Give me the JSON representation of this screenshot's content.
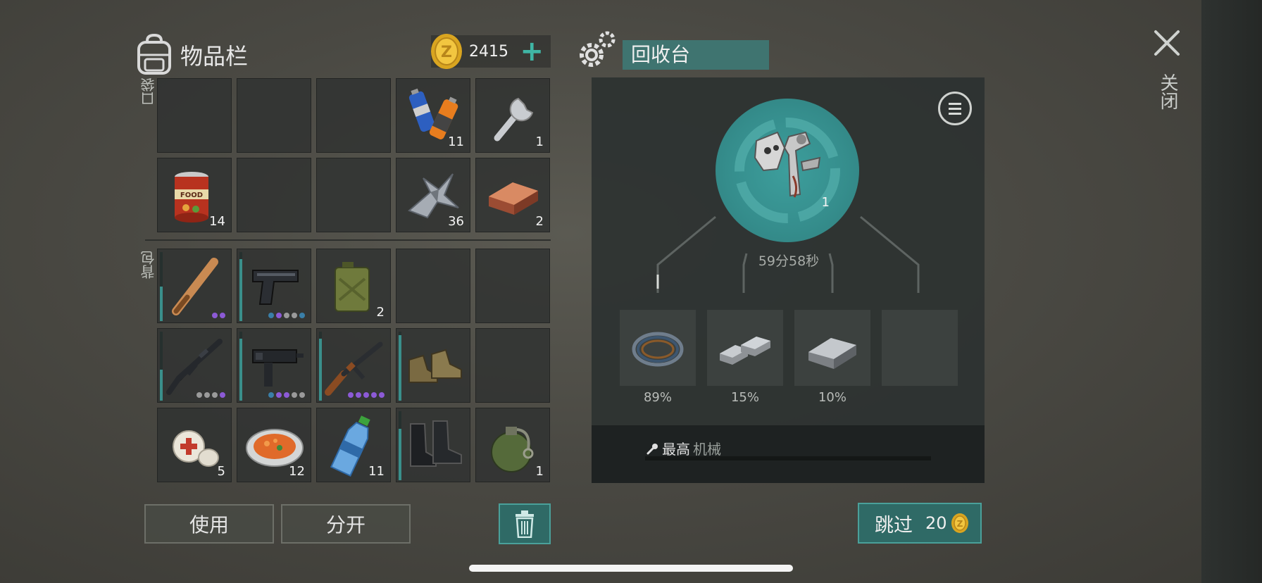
{
  "inventory": {
    "title": "物品栏",
    "coins": "2415",
    "plus": "+",
    "pocket_label": "口袋",
    "backpack_label": "背包",
    "pocket_slots": [
      {
        "icon": "",
        "qty": ""
      },
      {
        "icon": "",
        "qty": ""
      },
      {
        "icon": "",
        "qty": ""
      },
      {
        "icon": "batteries-icon",
        "qty": "11"
      },
      {
        "icon": "wrench-icon",
        "qty": "1"
      },
      {
        "icon": "canned-food-icon",
        "qty": "14"
      },
      {
        "icon": "",
        "qty": ""
      },
      {
        "icon": "",
        "qty": ""
      },
      {
        "icon": "scrap-metal-icon",
        "qty": "36"
      },
      {
        "icon": "copper-ingot-icon",
        "qty": "2"
      }
    ],
    "backpack_slots": [
      {
        "icon": "baseball-bat-icon",
        "qty": "",
        "durability": 0.5,
        "upgrade_dots": [
          "#8c5ad6",
          "#8c5ad6"
        ]
      },
      {
        "icon": "pistol-icon",
        "qty": "",
        "durability": 0.9,
        "upgrade_dots": [
          "#3a7fa8",
          "#8c5ad6",
          "#9a9a9a",
          "#9a9a9a",
          "#3a7fa8"
        ]
      },
      {
        "icon": "jerrycan-icon",
        "qty": "2",
        "durability": null,
        "upgrade_dots": []
      },
      {
        "icon": "",
        "qty": "",
        "durability": null,
        "upgrade_dots": []
      },
      {
        "icon": "",
        "qty": "",
        "durability": null,
        "upgrade_dots": []
      },
      {
        "icon": "assault-rifle-icon",
        "qty": "",
        "durability": 0.45,
        "upgrade_dots": [
          "#9a9a9a",
          "#9a9a9a",
          "#9a9a9a",
          "#8c5ad6"
        ]
      },
      {
        "icon": "uzi-icon",
        "qty": "",
        "durability": 0.9,
        "upgrade_dots": [
          "#3a7fa8",
          "#8c5ad6",
          "#8c5ad6",
          "#9a9a9a",
          "#9a9a9a"
        ]
      },
      {
        "icon": "ak-rifle-icon",
        "qty": "",
        "durability": 0.9,
        "upgrade_dots": [
          "#8c5ad6",
          "#8c5ad6",
          "#8c5ad6",
          "#8c5ad6",
          "#8c5ad6"
        ]
      },
      {
        "icon": "boots-icon",
        "qty": "",
        "durability": 0.95,
        "upgrade_dots": []
      },
      {
        "icon": "",
        "qty": "",
        "durability": null,
        "upgrade_dots": []
      },
      {
        "icon": "bandage-icon",
        "qty": "5",
        "durability": null,
        "upgrade_dots": []
      },
      {
        "icon": "food-plate-icon",
        "qty": "12",
        "durability": null,
        "upgrade_dots": []
      },
      {
        "icon": "water-bottle-icon",
        "qty": "11",
        "durability": null,
        "upgrade_dots": []
      },
      {
        "icon": "combat-boots-icon",
        "qty": "",
        "durability": 0.75,
        "upgrade_dots": []
      },
      {
        "icon": "grenade-icon",
        "qty": "1",
        "durability": null,
        "upgrade_dots": []
      }
    ],
    "use_label": "使用",
    "split_label": "分开"
  },
  "recycler": {
    "title": "回收台",
    "input_qty": "1",
    "timer": "59分58秒",
    "outputs": [
      {
        "icon": "wire-icon",
        "chance": "89%"
      },
      {
        "icon": "steel-bars-icon",
        "chance": "15%"
      },
      {
        "icon": "iron-ingot-icon",
        "chance": "10%"
      },
      {
        "icon": "",
        "chance": ""
      }
    ],
    "bench_label": "最高",
    "bench_type": "机械",
    "skip_label": "跳过",
    "skip_cost": "20"
  },
  "close_label": "关闭",
  "colors": {
    "accent": "#3fb6a5",
    "teal_button": "#2f6a66",
    "durability": "#3a8f8b"
  }
}
